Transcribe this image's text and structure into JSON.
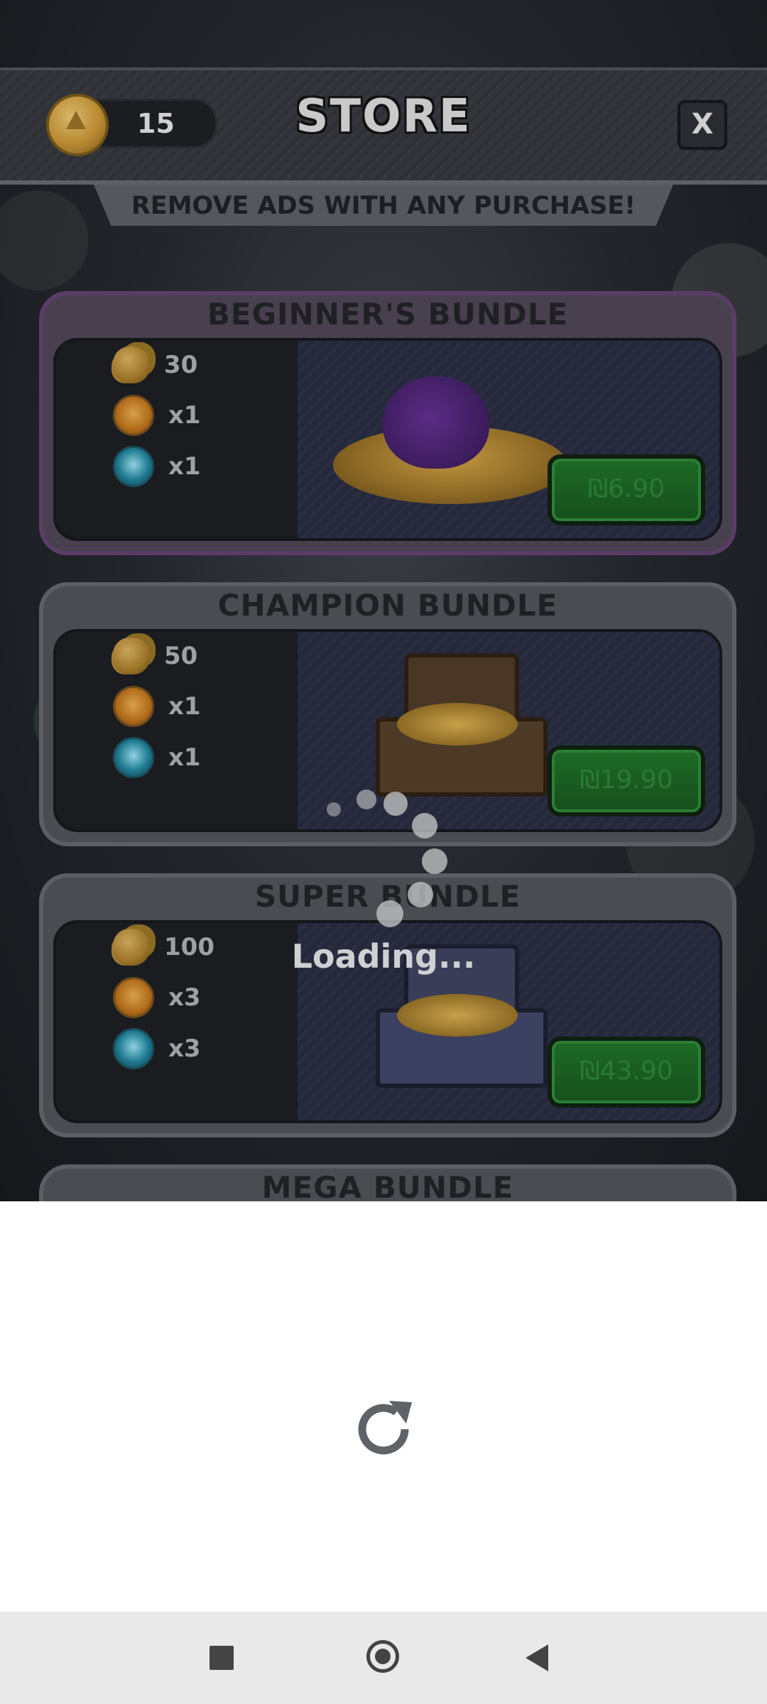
{
  "header": {
    "coin_count": "15",
    "title": "STORE",
    "close_label": "X"
  },
  "banner": {
    "text": "REMOVE ADS WITH ANY PURCHASE!"
  },
  "bundles": [
    {
      "title": "BEGINNER'S BUNDLE",
      "coins": "30",
      "orange_orbs": "x1",
      "blue_orbs": "x1",
      "price": "₪6.90"
    },
    {
      "title": "CHAMPION BUNDLE",
      "coins": "50",
      "orange_orbs": "x1",
      "blue_orbs": "x1",
      "price": "₪19.90"
    },
    {
      "title": "SUPER BUNDLE",
      "coins": "100",
      "orange_orbs": "x3",
      "blue_orbs": "x3",
      "price": "₪43.90"
    },
    {
      "title": "MEGA BUNDLE"
    }
  ],
  "loading": {
    "text": "Loading..."
  },
  "icons": {
    "reload": "reload-icon",
    "nav_recent": "square-icon",
    "nav_home": "circle-icon",
    "nav_back": "triangle-back-icon"
  },
  "colors": {
    "price_button": "#1d6a26",
    "nav_bar": "#e9e9e9",
    "reload_icon": "#5f6368"
  }
}
